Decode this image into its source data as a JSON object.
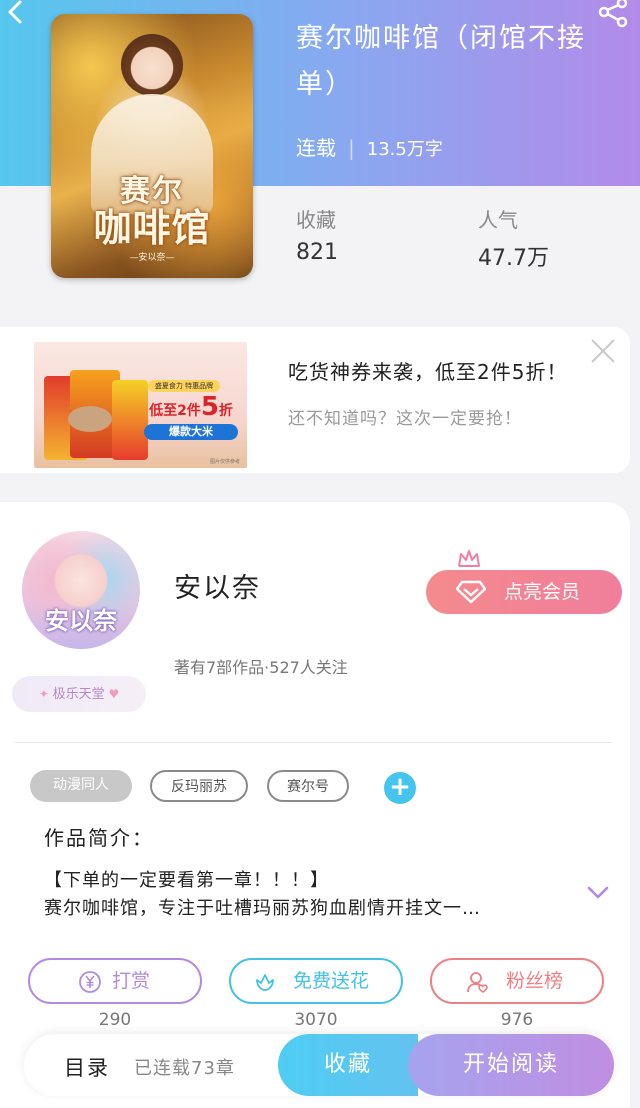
{
  "header": {
    "book_title": "赛尔咖啡馆（闭馆不接单）",
    "status": "连载",
    "word_count": "13.5万字",
    "cover_title_line1": "赛尔",
    "cover_title_line2": "咖啡馆",
    "cover_author": "—安以奈—"
  },
  "stats": [
    {
      "label": "收藏",
      "value": "821"
    },
    {
      "label": "人气",
      "value": "47.7万"
    }
  ],
  "ad": {
    "title": "吃货神券来袭，低至2件5折！",
    "subtitle": "还不知道吗？这次一定要抢！",
    "img_badge1": "盛夏食力 特惠品牌",
    "img_badge2_prefix": "低至2件",
    "img_badge2_num": "5",
    "img_badge2_suffix": "折",
    "img_badge3": "爆款大米",
    "img_tiny": "图片仅供参考"
  },
  "author": {
    "name": "安以奈",
    "meta": "著有7部作品·527人关注",
    "avatar_sig": "安以奈",
    "badge": "极乐天堂",
    "vip_label": "点亮会员"
  },
  "tags": [
    "动漫同人",
    "反玛丽苏",
    "赛尔号"
  ],
  "intro": {
    "label": "作品简介：",
    "line1": "【下单的一定要看第一章！！！】",
    "line2": "赛尔咖啡馆，专注于吐槽玛丽苏狗血剧情开挂文一…"
  },
  "actions": [
    {
      "label": "打赏",
      "count": "290",
      "color": "#b48ae0",
      "icon": "yen-icon"
    },
    {
      "label": "免费送花",
      "count": "3070",
      "color": "#44c2e6",
      "icon": "flower-icon"
    },
    {
      "label": "粉丝榜",
      "count": "976",
      "color": "#ef7f84",
      "icon": "fans-icon"
    }
  ],
  "bottom": {
    "toc_label": "目录",
    "toc_count": "已连载73章",
    "fav_label": "收藏",
    "read_label": "开始阅读"
  }
}
